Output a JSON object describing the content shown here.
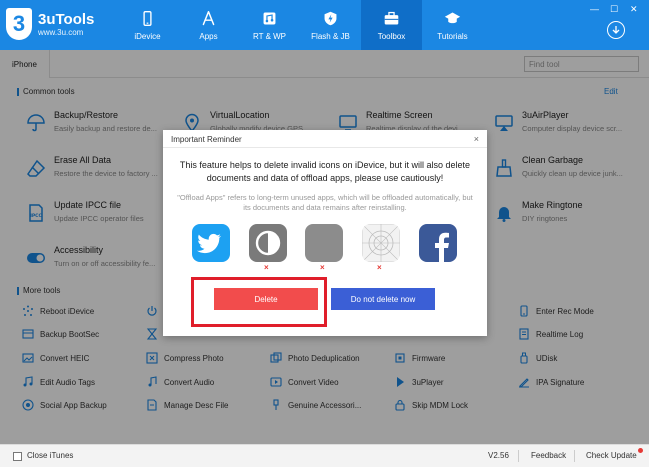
{
  "app": {
    "title": "3uTools",
    "url": "www.3u.com",
    "logo_glyph": "3"
  },
  "nav": [
    {
      "label": "iDevice",
      "icon": "phone-icon"
    },
    {
      "label": "Apps",
      "icon": "app-store-icon"
    },
    {
      "label": "RT & WP",
      "icon": "ringtone-icon"
    },
    {
      "label": "Flash & JB",
      "icon": "flash-icon"
    },
    {
      "label": "Toolbox",
      "icon": "toolbox-icon",
      "active": true
    },
    {
      "label": "Tutorials",
      "icon": "graduation-cap-icon"
    }
  ],
  "window_controls": {
    "minimize": "—",
    "maximize": "☐",
    "close": "✕"
  },
  "tabs": {
    "iphone": "iPhone"
  },
  "search": {
    "placeholder": "Find tool"
  },
  "common": {
    "title": "Common tools",
    "edit": "Edit",
    "tools": [
      {
        "name": "Backup/Restore",
        "desc": "Easily backup and restore de...",
        "icon": "umbrella-icon"
      },
      {
        "name": "VirtualLocation",
        "desc": "Globally modify device GPS",
        "icon": "location-pin-icon"
      },
      {
        "name": "Realtime Screen",
        "desc": "Realtime display of the devi...",
        "icon": "monitor-icon"
      },
      {
        "name": "3uAirPlayer",
        "desc": "Computer display device scr...",
        "icon": "airplay-icon"
      },
      {
        "name": "Erase All Data",
        "desc": "Restore the device to factory ...",
        "icon": "eraser-icon"
      },
      {
        "name": "Clean Garbage",
        "desc": "Quickly clean up device junk...",
        "icon": "broom-icon"
      },
      {
        "name": "Update IPCC file",
        "desc": "Update IPCC operator files",
        "icon": "ipcc-file-icon"
      },
      {
        "name": "Make Ringtone",
        "desc": "DIY ringtones",
        "icon": "bell-icon"
      },
      {
        "name": "Accessibility",
        "desc": "Turn on or off accessibility fe...",
        "icon": "toggle-icon"
      }
    ]
  },
  "more": {
    "title": "More tools",
    "tools": [
      {
        "label": "Reboot iDevice",
        "icon": "reboot-icon"
      },
      {
        "label": "Enter Rec Mode",
        "icon": "phone-rec-icon"
      },
      {
        "label": "Backup BootSec",
        "icon": "bootsec-icon"
      },
      {
        "label": "Realtime Log",
        "icon": "log-icon"
      },
      {
        "label": "Convert HEIC",
        "icon": "heic-icon"
      },
      {
        "label": "Compress Photo",
        "icon": "compress-photo-icon"
      },
      {
        "label": "Photo Deduplication",
        "icon": "photo-dedup-icon"
      },
      {
        "label": "Firmware",
        "icon": "firmware-icon"
      },
      {
        "label": "UDisk",
        "icon": "udisk-icon"
      },
      {
        "label": "Edit Audio Tags",
        "icon": "audio-tags-icon"
      },
      {
        "label": "Convert Audio",
        "icon": "convert-audio-icon"
      },
      {
        "label": "Convert Video",
        "icon": "convert-video-icon"
      },
      {
        "label": "3uPlayer",
        "icon": "player-icon"
      },
      {
        "label": "IPA Signature",
        "icon": "ipa-signature-icon"
      },
      {
        "label": "Social App Backup",
        "icon": "social-backup-icon"
      },
      {
        "label": "Manage Desc File",
        "icon": "desc-file-icon"
      },
      {
        "label": "Genuine Accessori...",
        "icon": "accessory-icon"
      },
      {
        "label": "Skip MDM Lock",
        "icon": "mdm-lock-icon"
      }
    ]
  },
  "dialog": {
    "title": "Important Reminder",
    "close": "×",
    "message": "This feature helps to delete invalid icons on iDevice, but it will also delete documents and data of offload apps, please use cautiously!",
    "note": "\"Offload Apps\" refers to long-term unused apps, which will be offloaded automatically, but its documents and data remains after reinstalling.",
    "apps": [
      "twitter-icon",
      "invalid-app-icon",
      "blank-app-icon",
      "placeholder-grid-icon",
      "facebook-icon"
    ],
    "x_mark": "×",
    "delete_label": "Delete",
    "keep_label": "Do not delete now"
  },
  "footer": {
    "close_itunes": "Close iTunes",
    "version": "V2.56",
    "feedback": "Feedback",
    "check_update": "Check Update"
  },
  "colors": {
    "brand": "#1b87e3",
    "delete": "#f24c4c",
    "primary_button": "#3b5fd6",
    "highlight": "#e01e2a"
  }
}
